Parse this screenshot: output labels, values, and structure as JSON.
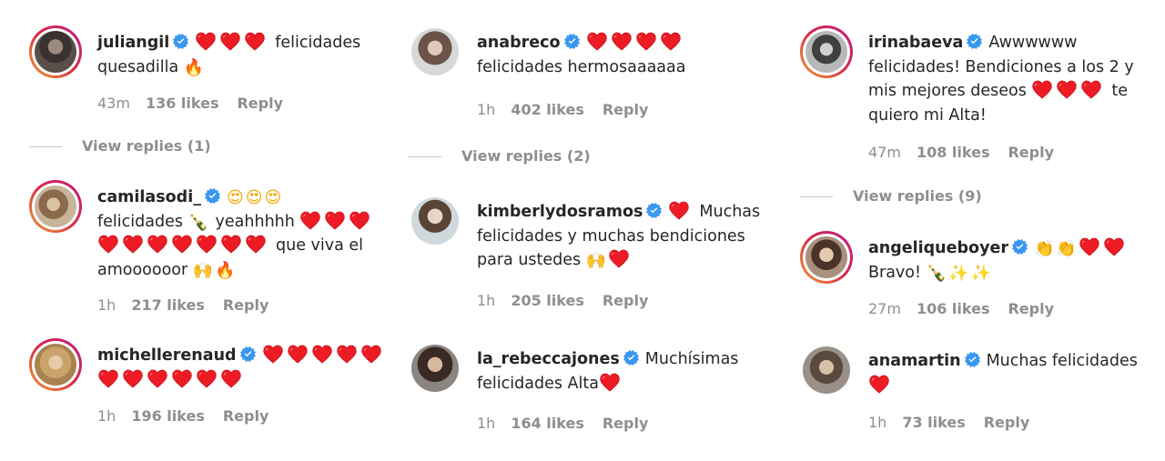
{
  "colors": {
    "text": "#262626",
    "secondary": "#8e8e8e",
    "verified": "#3897f0",
    "heart": "#ed1c24",
    "story_ring": "#dc2743"
  },
  "col1": {
    "c1": {
      "username": "juliangil",
      "text_a": "felicidades",
      "text_b": "quesadilla",
      "time": "43m",
      "likes": "136 likes",
      "reply": "Reply",
      "view_replies": "View replies (1)"
    },
    "c2": {
      "username": "camilasodi_",
      "text_a": "felicidades",
      "text_b": "yeahhhhh",
      "text_c": "que viva el",
      "text_d": "amoooooor",
      "time": "1h",
      "likes": "217 likes",
      "reply": "Reply"
    },
    "c3": {
      "username": "michellerenaud",
      "time": "1h",
      "likes": "196 likes",
      "reply": "Reply"
    }
  },
  "col2": {
    "c1": {
      "username": "anabreco",
      "text_a": "felicidades hermosaaaaaa",
      "time": "1h",
      "likes": "402 likes",
      "reply": "Reply",
      "view_replies": "View replies (2)"
    },
    "c2": {
      "username": "kimberlydosramos",
      "text_a": "Muchas",
      "text_b": "felicidades y muchas bendiciones",
      "text_c": "para ustedes",
      "time": "1h",
      "likes": "205 likes",
      "reply": "Reply"
    },
    "c3": {
      "username": "la_rebeccajones",
      "text_a": "Muchísimas",
      "text_b": "felicidades Alta",
      "time": "1h",
      "likes": "164 likes",
      "reply": "Reply"
    }
  },
  "col3": {
    "c1": {
      "username": "irinabaeva",
      "text_a": "Awwwwww",
      "text_b": "felicidades! Bendiciones a los 2 y",
      "text_c": "mis mejores deseos",
      "text_d": "te",
      "text_e": "quiero mi Alta!",
      "time": "47m",
      "likes": "108 likes",
      "reply": "Reply",
      "view_replies": "View replies (9)"
    },
    "c2": {
      "username": "angeliqueboyer",
      "text_a": "Bravo!",
      "time": "27m",
      "likes": "106 likes",
      "reply": "Reply"
    },
    "c3": {
      "username": "anamartin",
      "text_a": "Muchas felicidades",
      "time": "1h",
      "likes": "73 likes",
      "reply": "Reply"
    }
  },
  "emoji": {
    "heart": "❤",
    "fire": "🔥",
    "heart_eyes": "😍",
    "bottle": "🍾",
    "raised_hands": "🙌",
    "clap": "👏",
    "sparkles": "✨"
  }
}
